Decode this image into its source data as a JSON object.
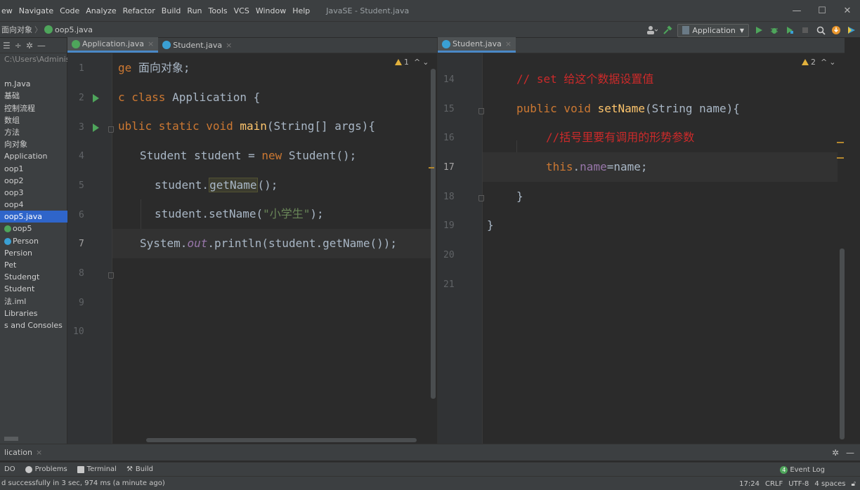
{
  "menubar": {
    "items": [
      "ew",
      "Navigate",
      "Code",
      "Analyze",
      "Refactor",
      "Build",
      "Run",
      "Tools",
      "VCS",
      "Window",
      "Help"
    ],
    "window_title": "JavaSE - Student.java",
    "controls": {
      "minimize": "—",
      "maximize": "☐",
      "close": "✕"
    }
  },
  "navbar": {
    "crumbs": [
      "面向对象",
      "oop5.java"
    ],
    "run_config": "Application",
    "icons": [
      "user-icon",
      "hammer-icon",
      "run-config-icon",
      "run-icon",
      "debug-icon",
      "coverage-icon",
      "stop-icon",
      "search-icon",
      "update-icon",
      "plugin-icon"
    ]
  },
  "project": {
    "path": "C:\\Users\\Adminis",
    "tree": [
      {
        "label": "m.Java",
        "selected": false
      },
      {
        "label": "基础",
        "selected": false
      },
      {
        "label": "控制流程",
        "selected": false
      },
      {
        "label": "数组",
        "selected": false
      },
      {
        "label": "方法",
        "selected": false
      },
      {
        "label": "向对象",
        "selected": false
      },
      {
        "label": "Application",
        "selected": false
      },
      {
        "label": "oop1",
        "selected": false
      },
      {
        "label": "oop2",
        "selected": false
      },
      {
        "label": "oop3",
        "selected": false
      },
      {
        "label": "oop4",
        "selected": false
      },
      {
        "label": "oop5.java",
        "selected": true
      },
      {
        "label": "oop5",
        "selected": false
      },
      {
        "label": "Person",
        "selected": false
      },
      {
        "label": "Persion",
        "selected": false
      },
      {
        "label": "Pet",
        "selected": false
      },
      {
        "label": "Studengt",
        "selected": false
      },
      {
        "label": "Student",
        "selected": false
      },
      {
        "label": "法.iml",
        "selected": false
      },
      {
        "label": "Libraries",
        "selected": false
      },
      {
        "label": "s and Consoles",
        "selected": false
      }
    ]
  },
  "left_editor": {
    "tabs": [
      {
        "label": "Application.java",
        "active": true
      },
      {
        "label": "Student.java",
        "active": false
      }
    ],
    "inspection_count": "1",
    "lines": [
      "1",
      "2",
      "3",
      "4",
      "5",
      "6",
      "7",
      "8",
      "9",
      "10"
    ],
    "current_line": "7",
    "code": {
      "l1_a": "ge ",
      "l1_b": "面向对象;",
      "l2_a": "c class ",
      "l2_b": "Application {",
      "l3_a": "ublic static void ",
      "l3_b": "main",
      "l3_c": "(String[] args){",
      "l4_a": "Student student = ",
      "l4_b": "new ",
      "l4_c": "Student();",
      "l5_a": "student.",
      "l5_b": "getName",
      "l5_c": "();",
      "l6_a": "student.setName(",
      "l6_b": "\"小学生\"",
      "l6_c": ");",
      "l7_a": "System.",
      "l7_b": "out",
      "l7_c": ".println(student.getName());"
    }
  },
  "right_editor": {
    "tabs": [
      {
        "label": "Student.java",
        "active": true
      }
    ],
    "inspection_count": "2",
    "lines": [
      "14",
      "15",
      "16",
      "17",
      "18",
      "19",
      "20",
      "21"
    ],
    "current_line": "17",
    "code": {
      "l14": "// set 给这个数据设置值",
      "l15_a": "public void ",
      "l15_b": "setName",
      "l15_c": "(String name){",
      "l16": "//括号里要有调用的形势参数",
      "l17_a": "this",
      "l17_b": ".",
      "l17_c": "name",
      "l17_d": "=name;",
      "l18": "}",
      "l19": "}"
    }
  },
  "bottom": {
    "run_tab": "lication",
    "tool_tabs": [
      "DO",
      "Problems",
      "Terminal",
      "Build"
    ],
    "event_log": "Event Log",
    "event_count": "4",
    "status_message": "d successfully in 3 sec, 974 ms (a minute ago)",
    "status_right": [
      "17:24",
      "CRLF",
      "UTF-8",
      "4 spaces"
    ]
  },
  "colors": {
    "keyword": "#cc7832",
    "function": "#ffc66d",
    "string": "#6a8759",
    "field": "#9876aa",
    "comment_red": "#cc2a2a",
    "selection": "#2f65ca"
  }
}
